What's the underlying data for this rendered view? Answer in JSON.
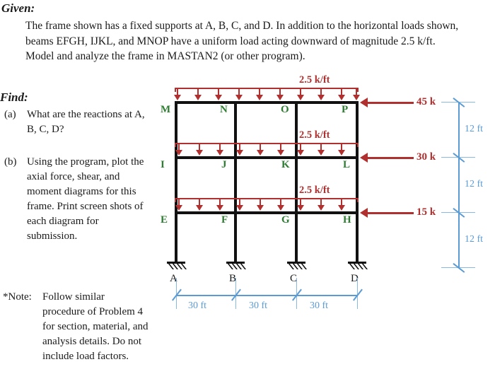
{
  "given": {
    "heading": "Given:",
    "body": "The frame shown has a fixed supports at A, B, C, and D.  In addition to the horizontal loads shown, beams EFGH, IJKL, and MNOP have a uniform load acting downward of magnitude 2.5 k/ft. Model and analyze the frame in MASTAN2 (or other program)."
  },
  "find": {
    "heading": "Find:",
    "items": [
      {
        "label": "(a)",
        "text": "What are the reactions at A, B, C, D?"
      },
      {
        "label": "(b)",
        "text": "Using the program, plot the axial force, shear, and moment diagrams for this frame.  Print screen shots of each diagram for submission."
      }
    ],
    "note_label": "*Note:",
    "note_text": "Follow similar procedure of Problem 4 for section, material, and analysis details. Do not include load factors."
  },
  "diagram": {
    "joint_labels": {
      "level_top": [
        "M",
        "N",
        "O",
        "P"
      ],
      "level_middle": [
        "I",
        "J",
        "K",
        "L"
      ],
      "level_lower": [
        "E",
        "F",
        "G",
        "H"
      ],
      "supports": [
        "A",
        "B",
        "C",
        "D"
      ]
    },
    "udl_label": "2.5 k/ft",
    "udl_labels": [
      "2.5 k/ft",
      "2.5 k/ft",
      "2.5 k/ft"
    ],
    "point_loads": [
      "45 k",
      "30 k",
      "15 k"
    ],
    "story_heights": [
      "12 ft",
      "12 ft",
      "12 ft"
    ],
    "bay_widths": [
      "30 ft",
      "30 ft",
      "30 ft"
    ],
    "colors": {
      "member": "#111111",
      "load": "#b03030",
      "joint": "#2e7d32",
      "dimension": "#5b9bd5"
    }
  }
}
